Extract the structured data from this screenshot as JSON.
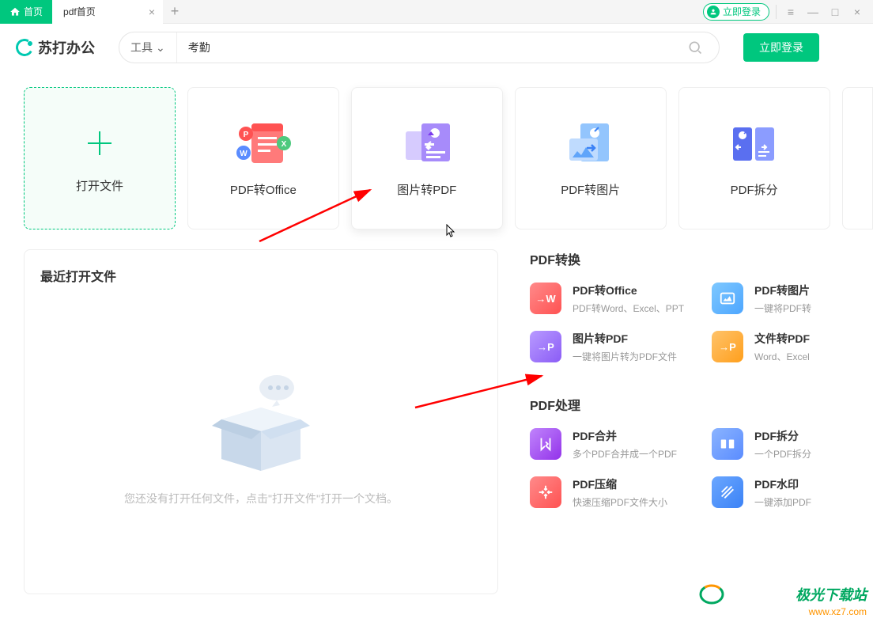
{
  "titlebar": {
    "home_tab": "首页",
    "tab1": "pdf首页",
    "login_pill": "立即登录"
  },
  "header": {
    "logo": "苏打办公",
    "tool_label": "工具",
    "search_value": "考勤",
    "login_btn": "立即登录"
  },
  "cards": {
    "open": "打开文件",
    "pdf_office": "PDF转Office",
    "img_pdf": "图片转PDF",
    "pdf_img": "PDF转图片",
    "pdf_split": "PDF拆分"
  },
  "recent": {
    "title": "最近打开文件",
    "empty": "您还没有打开任何文件，点击\"打开文件\"打开一个文档。"
  },
  "sections": {
    "convert": {
      "title": "PDF转换",
      "items": [
        {
          "title": "PDF转Office",
          "desc": "PDF转Word、Excel、PPT"
        },
        {
          "title": "PDF转图片",
          "desc": "一键将PDF转"
        },
        {
          "title": "图片转PDF",
          "desc": "一键将图片转为PDF文件"
        },
        {
          "title": "文件转PDF",
          "desc": "Word、Excel"
        }
      ]
    },
    "process": {
      "title": "PDF处理",
      "items": [
        {
          "title": "PDF合并",
          "desc": "多个PDF合并成一个PDF"
        },
        {
          "title": "PDF拆分",
          "desc": "一个PDF拆分"
        },
        {
          "title": "PDF压缩",
          "desc": "快速压缩PDF文件大小"
        },
        {
          "title": "PDF水印",
          "desc": "一键添加PDF"
        }
      ]
    }
  },
  "watermark": {
    "name": "极光下载站",
    "url": "www.xz7.com"
  }
}
